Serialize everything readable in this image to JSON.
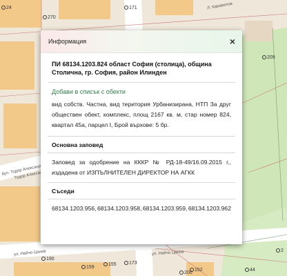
{
  "map": {
    "labels": {
      "street_top": "Л. Каравелов",
      "street_left_1": "Тодор Александров",
      "street_left_2": "бул. Тодор Александров",
      "street_bottom": "ул. Найчо Цанов",
      "street_bottom_2": "ул. Найчо Цанов"
    },
    "numbers": {
      "n1": "270",
      "n2": "171",
      "n3": "24",
      "n4": "209",
      "n5": "190",
      "n6": "155",
      "n7": "159",
      "n8": "173",
      "n9": "152",
      "n10": "44",
      "n11": "200",
      "n12": "2"
    }
  },
  "dialog": {
    "title": "Информация",
    "close_glyph": "×",
    "parcel_title": "ПИ 68134.1203.824 област София (столица), община Столична, гр. София, район Илинден",
    "add_link": "Добави в списък с обекти",
    "description": "вид собств. Частна, вид територия Урбанизирана, НТП За друг обществен обект, комплекс, площ 2167 кв. м, стар номер 824, квартал 45а, парцел I, Брой върхове: 5 бр.",
    "order_heading": "Основна заповед",
    "order_text": "Заповед за одобрение на КККР № РД-18-49/16.09.2015 г., издадена от ИЗПЪЛНИТЕЛЕН ДИРЕКТОР НА АГКК",
    "neighbors_heading": "Съседи",
    "neighbors": [
      "68134.1203.956,",
      "68134.1203.958,",
      "68134.1203.959,",
      "68134.1203.962"
    ]
  },
  "colors": {
    "link": "#2f7d4a",
    "map_bg": "#efe7d9",
    "building": "#f3c98a",
    "park": "#cfe7b8"
  }
}
